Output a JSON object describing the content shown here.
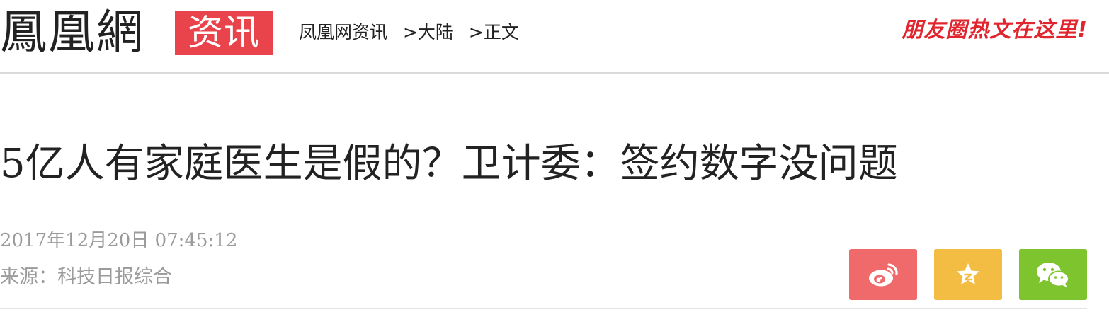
{
  "header": {
    "logo": "鳳凰網",
    "channel": "资讯",
    "breadcrumb": [
      {
        "label": "凤凰网资讯"
      },
      {
        "label": ">大陆"
      },
      {
        "label": ">正文"
      }
    ],
    "promo": "朋友圈热文在这里!"
  },
  "article": {
    "title": "5亿人有家庭医生是假的？卫计委：签约数字没问题",
    "datetime": "2017年12月20日  07:45:12",
    "source": "来源：科技日报综合"
  },
  "share": {
    "buttons": [
      {
        "icon": "weibo-icon",
        "color": "#f06a6c"
      },
      {
        "icon": "star-icon",
        "color": "#f2bd42"
      },
      {
        "icon": "wechat-icon",
        "color": "#7ec42e"
      }
    ]
  },
  "colors": {
    "brand_red": "#e9444b",
    "promo_red": "#e1252e",
    "meta_gray": "#9b9b9b",
    "divider": "#d9d9d9"
  }
}
